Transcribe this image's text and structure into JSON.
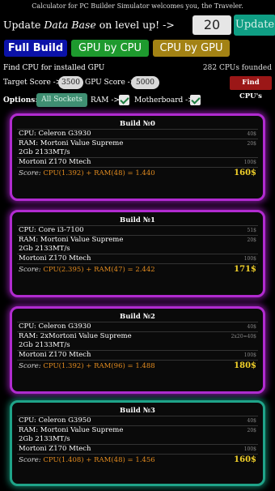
{
  "banner": "Calculator for PC Builder Simulator welcomes you, the Traveler.",
  "update": {
    "label_prefix": "Update ",
    "label_italic": "Data Base",
    "label_suffix": " on level up! ->",
    "level": "20",
    "button": "Update"
  },
  "modes": {
    "full_build": "Full Build",
    "gpu_by_cpu": "GPU by CPU",
    "cpu_by_gpu": "CPU by GPU"
  },
  "find": {
    "title": "Find CPU for installed GPU",
    "count": "282 CPUs founded"
  },
  "scores": {
    "target_label": "Target Score ->",
    "target_value": "3500",
    "gpu_label": "GPU Score ->",
    "gpu_value": "5000",
    "find_button": "Find CPU's"
  },
  "options": {
    "label": "Options:",
    "all_sockets": "All Sockets",
    "ram_label": "RAM ->",
    "ram_checked": true,
    "motherboard_label": "Motherboard ->",
    "motherboard_checked": true
  },
  "builds": [
    {
      "title": "Build №0",
      "cpu": "CPU: Celeron G3930",
      "cpu_price": "40$",
      "ram_line1": "RAM: Mortoni Value Supreme",
      "ram_line2": "2Gb 2133MT/s",
      "ram_price": "20$",
      "mobo": "Mortoni Z170 Mtech",
      "mobo_price": "100$",
      "score_label": "Score: ",
      "score_formula": "CPU(1.392) + RAM(48) = 1.440",
      "total": "160$",
      "color": "#b12bd0"
    },
    {
      "title": "Build №1",
      "cpu": "CPU: Core i3-7100",
      "cpu_price": "51$",
      "ram_line1": "RAM: Mortoni Value Supreme",
      "ram_line2": "2Gb 2133MT/s",
      "ram_price": "20$",
      "mobo": "Mortoni Z170 Mtech",
      "mobo_price": "100$",
      "score_label": "Score: ",
      "score_formula": "CPU(2.395) + RAM(47) = 2.442",
      "total": "171$",
      "color": "#b12bd0"
    },
    {
      "title": "Build №2",
      "cpu": "CPU: Celeron G3930",
      "cpu_price": "40$",
      "ram_line1": "RAM: 2xMortoni Value Supreme",
      "ram_line2": "2Gb 2133MT/s",
      "ram_price": "2x20=40$",
      "mobo": "Mortoni Z170 Mtech",
      "mobo_price": "100$",
      "score_label": "Score: ",
      "score_formula": "CPU(1.392) + RAM(96) = 1.488",
      "total": "180$",
      "color": "#b12bd0"
    },
    {
      "title": "Build №3",
      "cpu": "CPU: Celeron G3950",
      "cpu_price": "40$",
      "ram_line1": "RAM: Mortoni Value Supreme",
      "ram_line2": "2Gb 2133MT/s",
      "ram_price": "20$",
      "mobo": "Mortoni Z170 Mtech",
      "mobo_price": "100$",
      "score_label": "Score: ",
      "score_formula": "CPU(1.408) + RAM(48) = 1.456",
      "total": "160$",
      "color": "#1fa489"
    }
  ]
}
